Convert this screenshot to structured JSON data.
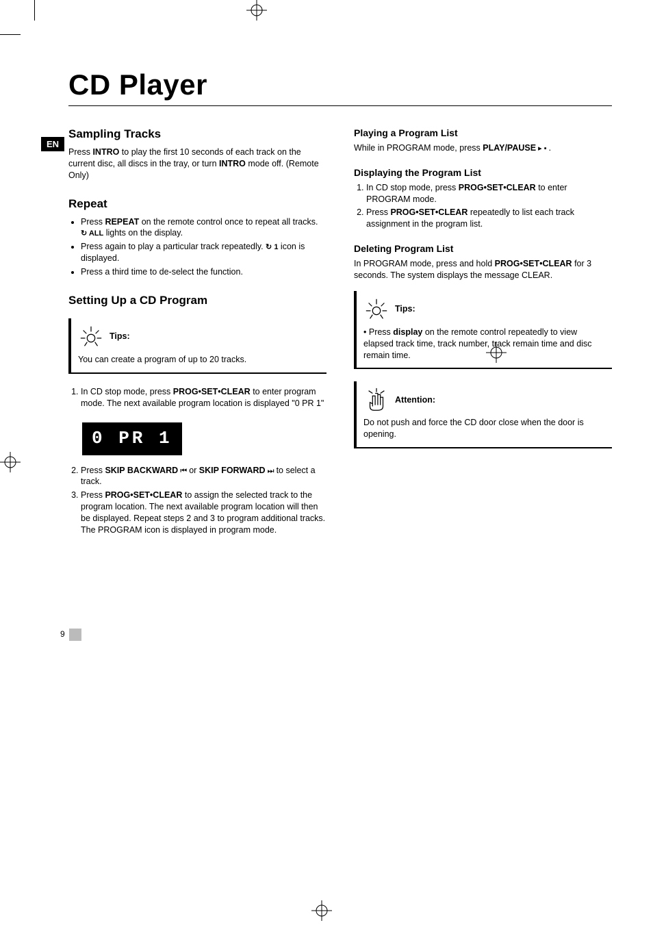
{
  "lang_badge": "EN",
  "title": "CD Player",
  "page_number": "9",
  "left": {
    "sampling_heading": "Sampling Tracks",
    "sampling_p1_a": "Press ",
    "sampling_p1_b": "INTRO",
    "sampling_p1_c": " to play the first 10 seconds of each track on the current disc, all discs in the tray, or turn ",
    "sampling_p1_d": "INTRO",
    "sampling_p1_e": " mode off.  (Remote Only)",
    "repeat_heading": "Repeat",
    "repeat_b1_a": "Press ",
    "repeat_b1_b": "REPEAT",
    "repeat_b1_c": " on the remote control once to repeat all tracks.  ",
    "repeat_b1_icon_label": "↻ ALL",
    "repeat_b1_d": "  lights on the display.",
    "repeat_b2_a": "Press again to play a particular track repeatedly.  ",
    "repeat_b2_icon_label": "↻ 1",
    "repeat_b2_b": "  icon is displayed.",
    "repeat_b3": "Press a third time to de-select the function.",
    "setup_heading": "Setting Up a CD Program",
    "tips_label": "Tips:",
    "tips_body": "You can create a program of up to 20 tracks.",
    "setup_s1_a": "In CD stop mode, press ",
    "setup_s1_b": "PROG•SET•CLEAR",
    "setup_s1_c": " to enter program mode. The next available program location is displayed \"0 PR 1\"",
    "lcd_text": "0 PR   1",
    "setup_s2_a": "Press ",
    "setup_s2_b": "SKIP BACKWARD",
    "setup_s2_icon1": " ⏮ ",
    "setup_s2_c": " or ",
    "setup_s2_d": "SKIP FORWARD",
    "setup_s2_icon2": " ⏭ ",
    "setup_s2_e": "  to select a track.",
    "setup_s3_a": "Press ",
    "setup_s3_b": "PROG•SET•CLEAR",
    "setup_s3_c": " to assign the selected track to the program location. The next available program location will then be displayed. Repeat steps 2 and 3 to program additional tracks.",
    "setup_s3_d": "The PROGRAM icon is displayed in program mode."
  },
  "right": {
    "playing_heading": "Playing a Program List",
    "playing_p1_a": "While in PROGRAM mode, press ",
    "playing_p1_b": "PLAY/PAUSE",
    "playing_p1_icon": " ▸ ▪ ",
    "playing_p1_c": " .",
    "displaying_heading": "Displaying the Program List",
    "displaying_s1_a": "In CD stop mode, press ",
    "displaying_s1_b": "PROG•SET•CLEAR",
    "displaying_s1_c": " to enter PROGRAM mode.",
    "displaying_s2_a": "Press ",
    "displaying_s2_b": "PROG•SET•CLEAR",
    "displaying_s2_c": " repeatedly to list each track assignment in the program list.",
    "deleting_heading": "Deleting Program List",
    "deleting_p1_a": "In PROGRAM mode, press and hold ",
    "deleting_p1_b": "PROG•SET•CLEAR",
    "deleting_p1_c": " for 3 seconds.  The system displays the message CLEAR.",
    "tips2_label": "Tips:",
    "tips2_bullet_a": "Press ",
    "tips2_bullet_b": "display",
    "tips2_bullet_c": " on the remote control repeatedly to view elapsed track time, track number, track remain time and disc remain time.",
    "attention_label": "Attention:",
    "attention_body": "Do not push and force the CD door close when the door is opening."
  }
}
